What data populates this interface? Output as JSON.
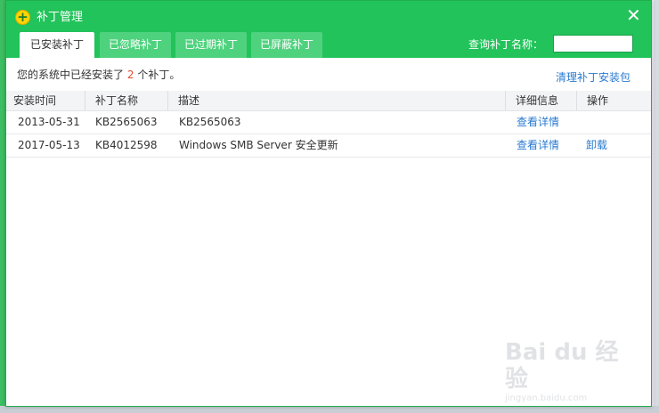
{
  "window": {
    "title": "补丁管理",
    "close_glyph": "✕"
  },
  "tabs": [
    {
      "label": "已安装补丁",
      "active": true
    },
    {
      "label": "已忽略补丁",
      "active": false
    },
    {
      "label": "已过期补丁",
      "active": false
    },
    {
      "label": "已屏蔽补丁",
      "active": false
    }
  ],
  "search": {
    "label": "查询补丁名称：",
    "value": ""
  },
  "summary": {
    "prefix": "您的系统中已经安装了",
    "count": "2",
    "suffix": "个补丁。"
  },
  "clean_link": "清理补丁安装包",
  "table": {
    "headers": [
      "安装时间",
      "补丁名称",
      "描述",
      "详细信息",
      "操作"
    ],
    "rows": [
      {
        "date": "2013-05-31",
        "name": "KB2565063",
        "desc": "KB2565063",
        "detail": "查看详情",
        "action": ""
      },
      {
        "date": "2017-05-13",
        "name": "KB4012598",
        "desc": "Windows SMB Server 安全更新",
        "detail": "查看详情",
        "action": "卸载"
      }
    ]
  },
  "watermark": {
    "main": "Bai du 经验",
    "sub": "jingyan.baidu.com"
  },
  "colors": {
    "title_bar": "#22c35a",
    "tab_inactive": "#4fd27e",
    "link": "#2a7ad0",
    "count_highlight": "#e04b2b"
  },
  "icons": {
    "app_logo": "plus-circle-icon",
    "close": "close-icon"
  }
}
